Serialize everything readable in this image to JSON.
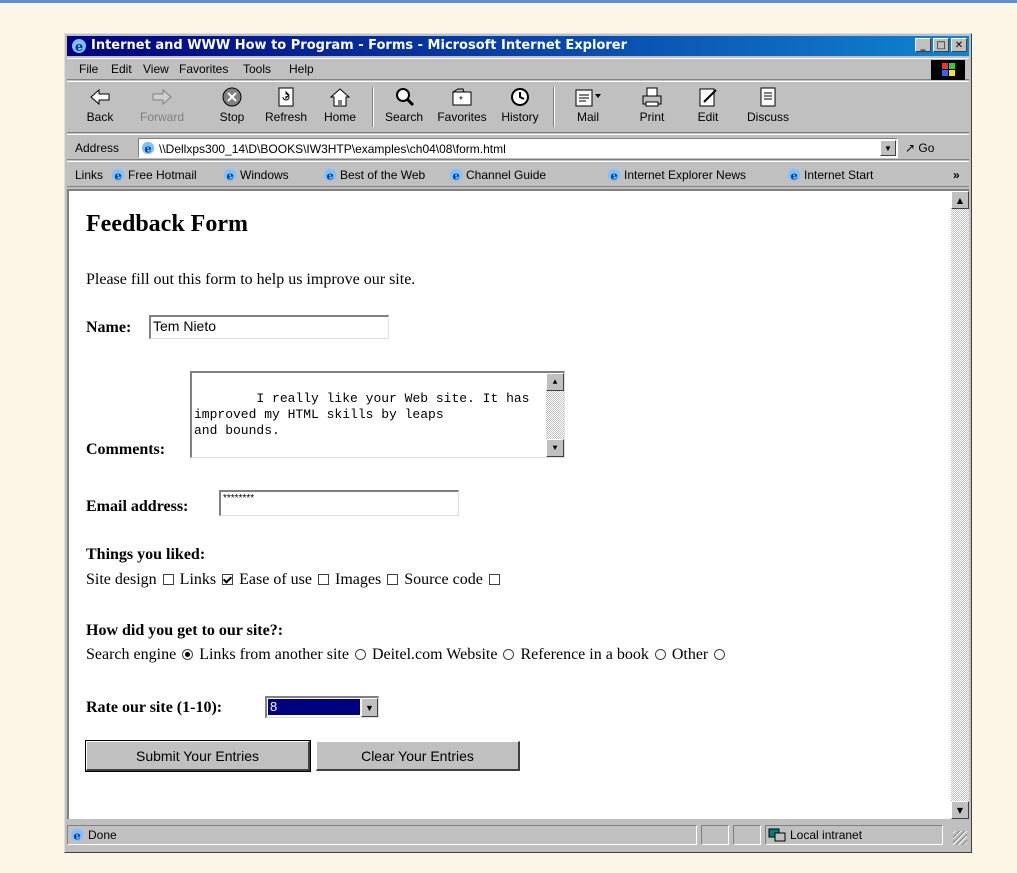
{
  "window": {
    "title": "Internet and WWW How to Program - Forms - Microsoft Internet Explorer"
  },
  "menu": [
    "File",
    "Edit",
    "View",
    "Favorites",
    "Tools",
    "Help"
  ],
  "toolbar": [
    {
      "label": "Back",
      "icon": "back-arrow-icon",
      "enabled": true
    },
    {
      "label": "Forward",
      "icon": "forward-arrow-icon",
      "enabled": false
    },
    {
      "label": "Stop",
      "icon": "stop-icon",
      "enabled": true
    },
    {
      "label": "Refresh",
      "icon": "refresh-icon",
      "enabled": true
    },
    {
      "label": "Home",
      "icon": "home-icon",
      "enabled": true
    },
    {
      "label": "Search",
      "icon": "search-icon",
      "enabled": true
    },
    {
      "label": "Favorites",
      "icon": "favorites-icon",
      "enabled": true
    },
    {
      "label": "History",
      "icon": "history-icon",
      "enabled": true
    },
    {
      "label": "Mail",
      "icon": "mail-icon",
      "enabled": true
    },
    {
      "label": "Print",
      "icon": "print-icon",
      "enabled": true
    },
    {
      "label": "Edit",
      "icon": "edit-icon",
      "enabled": true
    },
    {
      "label": "Discuss",
      "icon": "discuss-icon",
      "enabled": true
    }
  ],
  "address": {
    "label": "Address",
    "value": "\\\\Dellxps300_14\\D\\BOOKS\\IW3HTP\\examples\\ch04\\08\\form.html",
    "go": "Go"
  },
  "links": {
    "label": "Links",
    "items": [
      "Free Hotmail",
      "Windows",
      "Best of the Web",
      "Channel Guide",
      "Internet Explorer News",
      "Internet Start"
    ]
  },
  "page": {
    "heading": "Feedback Form",
    "intro": "Please fill out this form to help us improve our site.",
    "name_label": "Name:",
    "name_value": "Tem Nieto",
    "comments_label": "Comments:",
    "comments_value": "I really like your Web site. It has\nimproved my HTML skills by leaps\nand bounds.",
    "email_label": "Email address:",
    "email_value": "********",
    "liked_label": "Things you liked:",
    "liked_options": [
      {
        "label": "Site design",
        "checked": false
      },
      {
        "label": "Links",
        "checked": true
      },
      {
        "label": "Ease of use",
        "checked": false
      },
      {
        "label": "Images",
        "checked": false
      },
      {
        "label": "Source code",
        "checked": false
      }
    ],
    "how_label": "How did you get to our site?:",
    "how_options": [
      {
        "label": "Search engine",
        "selected": true
      },
      {
        "label": "Links from another site",
        "selected": false
      },
      {
        "label": "Deitel.com Website",
        "selected": false
      },
      {
        "label": "Reference in a book",
        "selected": false
      },
      {
        "label": "Other",
        "selected": false
      }
    ],
    "rate_label": "Rate our site (1-10):",
    "rate_value": "8",
    "submit_label": "Submit Your Entries",
    "clear_label": "Clear Your Entries"
  },
  "status": {
    "text": "Done",
    "zone": "Local intranet"
  },
  "colors": {
    "titlebar": "#000080",
    "chrome": "#c0c0c0",
    "background": "#fef7e8"
  }
}
